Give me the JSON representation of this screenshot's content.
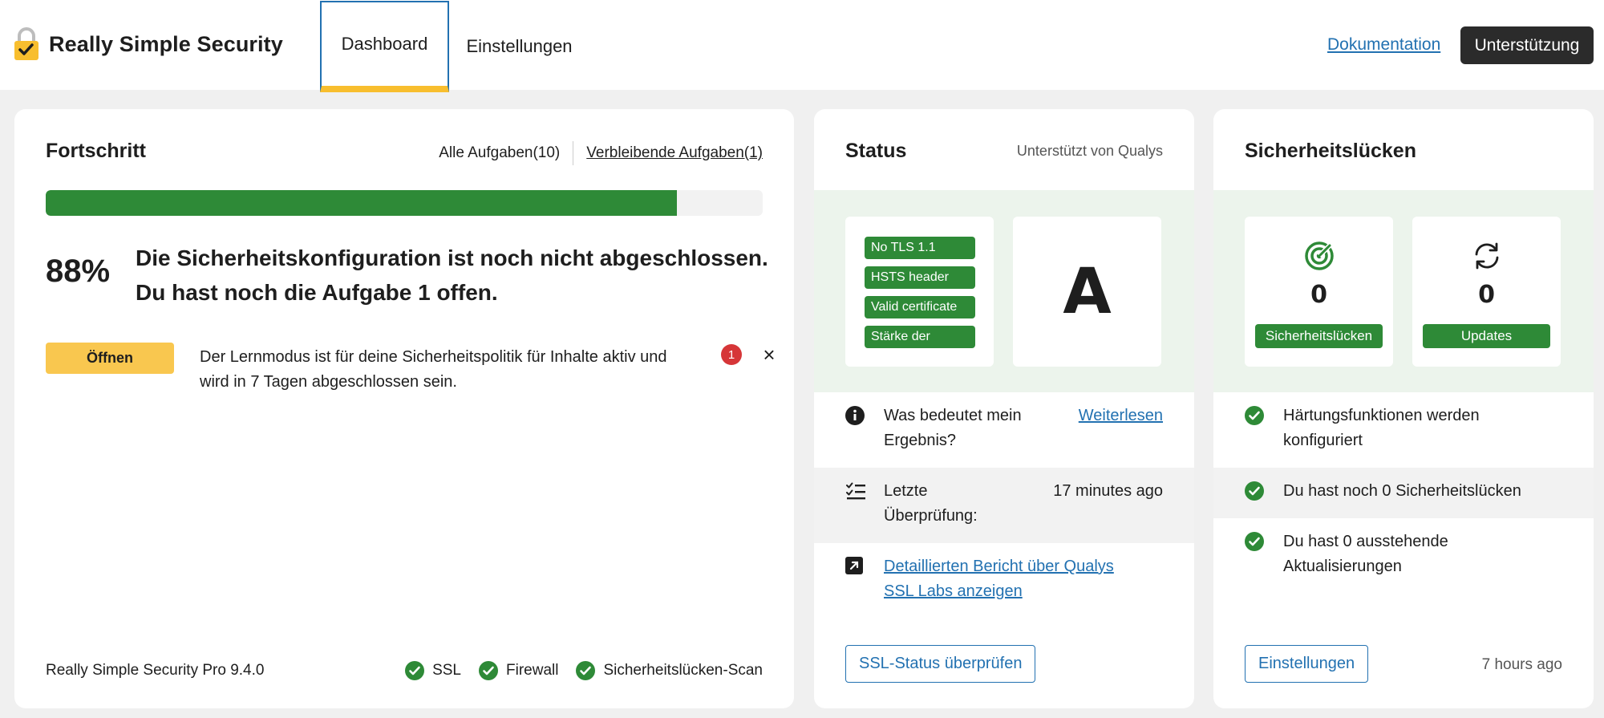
{
  "header": {
    "brand": "Really Simple Security",
    "tabs": [
      {
        "label": "Dashboard",
        "active": true
      },
      {
        "label": "Einstellungen",
        "active": false
      }
    ],
    "doc_link": "Dokumentation",
    "support_button": "Unterstützung"
  },
  "progress": {
    "title": "Fortschritt",
    "all_tasks": "Alle Aufgaben(10)",
    "remaining_tasks": "Verbleibende Aufgaben(1)",
    "percent_value": 88,
    "percent_label": "88%",
    "message_line1": "Die Sicherheitskonfiguration ist noch nicht abgeschlossen.",
    "message_line2": "Du hast noch die Aufgabe 1 offen.",
    "task": {
      "badge": "Öffnen",
      "text": "Der Lernmodus ist für deine Sicherheitspolitik für Inhalte aktiv und wird in 7 Tagen abgeschlossen sein.",
      "count": "1",
      "dismiss": "×"
    },
    "footer": {
      "version": "Really Simple Security Pro 9.4.0",
      "checks": [
        "SSL",
        "Firewall",
        "Sicherheitslücken-Scan"
      ]
    }
  },
  "status": {
    "title": "Status",
    "subtitle": "Unterstützt von Qualys",
    "tags": [
      "No TLS 1.1",
      "HSTS header",
      "Valid certificate",
      "Stärke der"
    ],
    "grade": "A",
    "rows": {
      "result_question": "Was bedeutet mein Ergebnis?",
      "read_more": "Weiterlesen",
      "last_check_label": "Letzte Überprüfung:",
      "last_check_value": "17 minutes ago",
      "report_link": "Detaillierten Bericht über Qualys SSL Labs anzeigen"
    },
    "check_button": "SSL-Status überprüfen"
  },
  "vulnerabilities": {
    "title": "Sicherheitslücken",
    "tiles": [
      {
        "icon": "radar-icon",
        "count": "0",
        "button": "Sicherheitslücken"
      },
      {
        "icon": "refresh-icon",
        "count": "0",
        "button": "Updates"
      }
    ],
    "items": [
      "Härtungsfunktionen werden konfiguriert",
      "Du hast noch 0 Sicherheitslücken",
      "Du hast 0 ausstehende Aktualisierungen"
    ],
    "settings_button": "Einstellungen",
    "time": "7 hours ago"
  },
  "colors": {
    "accent_green": "#2e8a37",
    "link_blue": "#2271b1",
    "badge_yellow": "#f9c74f",
    "alert_red": "#d63638"
  }
}
